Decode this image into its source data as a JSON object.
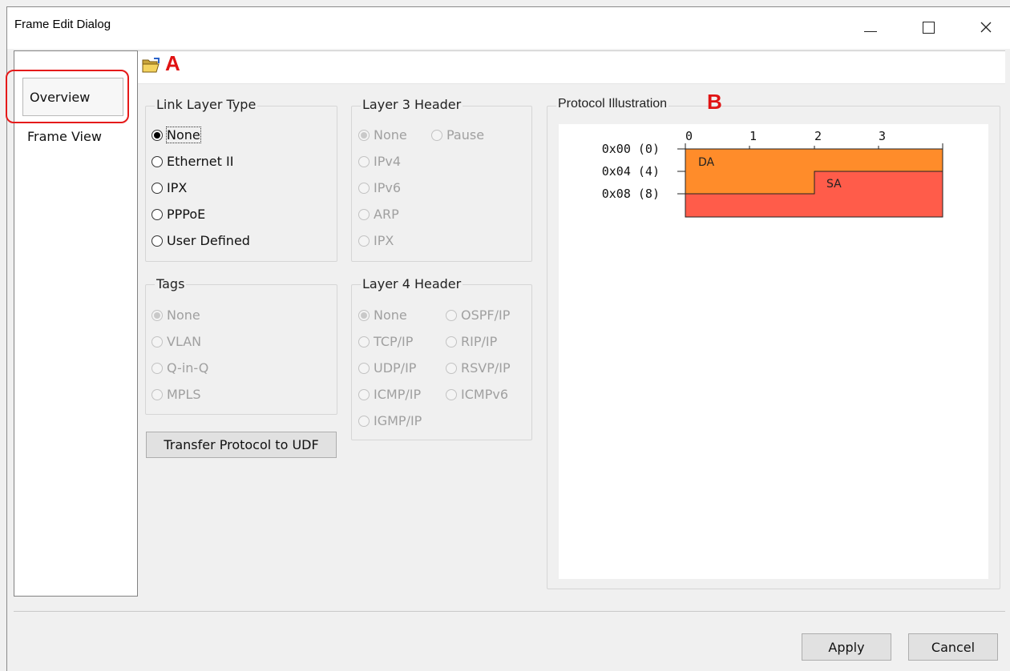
{
  "window": {
    "title": "Frame Edit Dialog",
    "minimize_glyph": "—",
    "maximize_glyph": "☐",
    "close_glyph": "✕"
  },
  "nav": {
    "items": [
      {
        "label": "Overview",
        "selected": true
      },
      {
        "label": "Frame View",
        "selected": false
      }
    ]
  },
  "annotations": {
    "a": "A",
    "b": "B",
    "color": "#e01313"
  },
  "toolbar": {
    "open_icon": "open-folder-icon"
  },
  "link_layer": {
    "title": "Link Layer Type",
    "options": [
      {
        "label": "None",
        "checked": true,
        "disabled": false
      },
      {
        "label": "Ethernet II",
        "checked": false,
        "disabled": false
      },
      {
        "label": "IPX",
        "checked": false,
        "disabled": false
      },
      {
        "label": "PPPoE",
        "checked": false,
        "disabled": false
      },
      {
        "label": "User Defined",
        "checked": false,
        "disabled": false
      }
    ]
  },
  "layer3": {
    "title": "Layer 3 Header",
    "options": [
      {
        "label": "None",
        "checked": true,
        "disabled": true
      },
      {
        "label": "Pause",
        "checked": false,
        "disabled": true
      },
      {
        "label": "IPv4",
        "checked": false,
        "disabled": true
      },
      {
        "label": "IPv6",
        "checked": false,
        "disabled": true
      },
      {
        "label": "ARP",
        "checked": false,
        "disabled": true
      },
      {
        "label": "IPX",
        "checked": false,
        "disabled": true
      }
    ]
  },
  "tags": {
    "title": "Tags",
    "options": [
      {
        "label": "None",
        "checked": true,
        "disabled": true
      },
      {
        "label": "VLAN",
        "checked": false,
        "disabled": true
      },
      {
        "label": "Q-in-Q",
        "checked": false,
        "disabled": true
      },
      {
        "label": "MPLS",
        "checked": false,
        "disabled": true
      }
    ]
  },
  "layer4": {
    "title": "Layer 4 Header",
    "options": [
      {
        "label": "None",
        "checked": true,
        "disabled": true
      },
      {
        "label": "OSPF/IP",
        "checked": false,
        "disabled": true
      },
      {
        "label": "TCP/IP",
        "checked": false,
        "disabled": true
      },
      {
        "label": "RIP/IP",
        "checked": false,
        "disabled": true
      },
      {
        "label": "UDP/IP",
        "checked": false,
        "disabled": true
      },
      {
        "label": "RSVP/IP",
        "checked": false,
        "disabled": true
      },
      {
        "label": "ICMP/IP",
        "checked": false,
        "disabled": true
      },
      {
        "label": "ICMPv6",
        "checked": false,
        "disabled": true
      },
      {
        "label": "IGMP/IP",
        "checked": false,
        "disabled": true
      }
    ]
  },
  "transfer_button": "Transfer Protocol to UDF",
  "illustration": {
    "title": "Protocol Illustration",
    "col_labels": [
      "0",
      "1",
      "2",
      "3"
    ],
    "row_labels": [
      "0x00 (0)",
      "0x04 (4)",
      "0x08 (8)"
    ],
    "fields": [
      {
        "name": "DA",
        "color": "#ff8c2a"
      },
      {
        "name": "SA",
        "color": "#ff5c4a"
      }
    ]
  },
  "footer": {
    "apply": "Apply",
    "cancel": "Cancel"
  }
}
